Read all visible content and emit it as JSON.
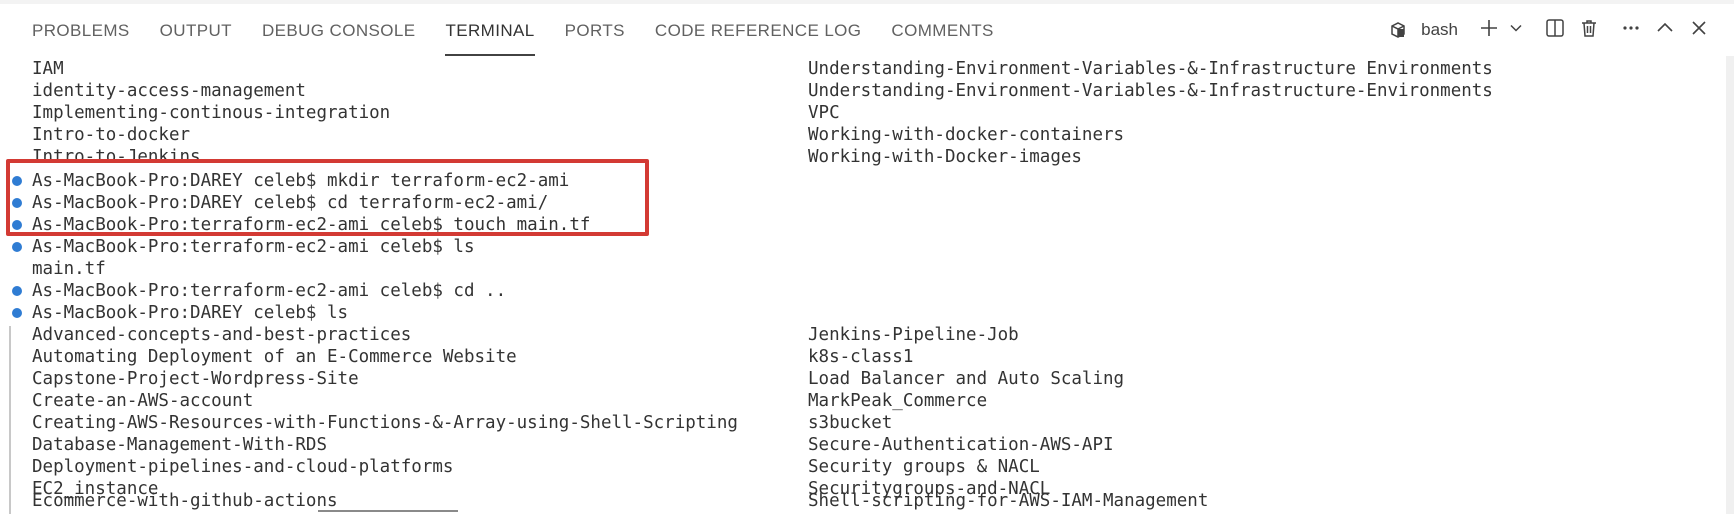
{
  "panel_tabs": [
    {
      "label": "PROBLEMS",
      "active": false
    },
    {
      "label": "OUTPUT",
      "active": false
    },
    {
      "label": "DEBUG CONSOLE",
      "active": false
    },
    {
      "label": "TERMINAL",
      "active": true
    },
    {
      "label": "PORTS",
      "active": false
    },
    {
      "label": "CODE REFERENCE LOG",
      "active": false
    },
    {
      "label": "COMMENTS",
      "active": false
    }
  ],
  "toolbar": {
    "shell_name": "bash",
    "icons": [
      "terminal-shell-icon",
      "plus-icon",
      "chevron-down-icon",
      "split-icon",
      "trash-icon",
      "ellipsis-icon",
      "chevron-up-icon",
      "close-icon"
    ]
  },
  "terminal": {
    "top_listing_left": [
      "IAM",
      "identity-access-management",
      "Implementing-continous-integration",
      "Intro-to-docker",
      "Intro-to-Jenkins"
    ],
    "top_listing_right": [
      "Understanding-Environment-Variables-&-Infrastructure Environments",
      "Understanding-Environment-Variables-&-Infrastructure-Environments",
      "VPC",
      "Working-with-docker-containers",
      "Working-with-Docker-images"
    ],
    "commands": [
      "As-MacBook-Pro:DAREY celeb$ mkdir terraform-ec2-ami",
      "As-MacBook-Pro:DAREY celeb$ cd terraform-ec2-ami/",
      "As-MacBook-Pro:terraform-ec2-ami celeb$ touch main.tf",
      "As-MacBook-Pro:terraform-ec2-ami celeb$ ls",
      "main.tf",
      "As-MacBook-Pro:terraform-ec2-ami celeb$ cd ..",
      "As-MacBook-Pro:DAREY celeb$ ls"
    ],
    "bottom_listing_left": [
      "Advanced-concepts-and-best-practices",
      "Automating Deployment of an E-Commerce Website",
      "Capstone-Project-Wordpress-Site",
      "Create-an-AWS-account",
      "Creating-AWS-Resources-with-Functions-&-Array-using-Shell-Scripting",
      "Database-Management-With-RDS",
      "Deployment-pipelines-and-cloud-platforms",
      "EC2_instance",
      "Ecommerce-with-github-actions"
    ],
    "bottom_listing_right": [
      "Jenkins-Pipeline-Job",
      "k8s-class1",
      "Load Balancer and Auto Scaling",
      "MarkPeak_Commerce",
      "s3bucket",
      "Secure-Authentication-AWS-API",
      "Security groups & NACL",
      "Securitygroups-and-NACL",
      "Shell-scripting-for-AWS-IAM-Management"
    ]
  },
  "colors": {
    "highlight_border": "#d33a34",
    "prompt_dot": "#2f7cd3",
    "active_tab_underline": "#424242"
  }
}
